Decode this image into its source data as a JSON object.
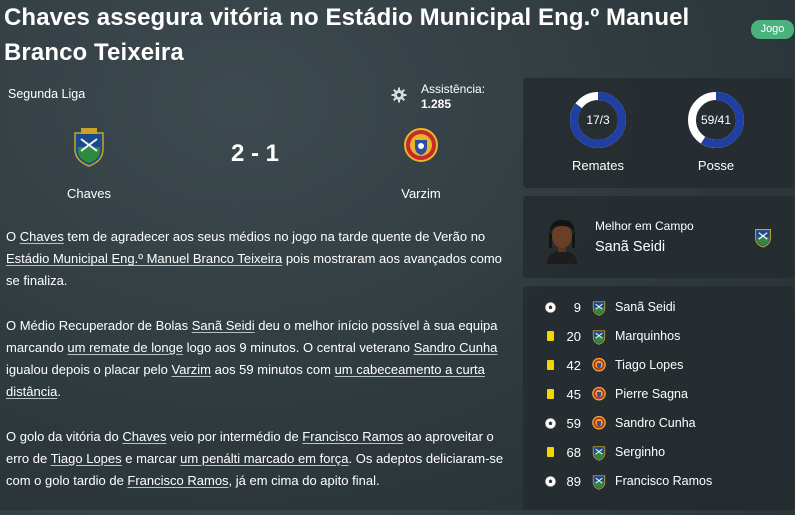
{
  "headline": "Chaves assegura vitória no Estádio Municipal Eng.º Manuel Branco Teixeira",
  "badge": "Jogo",
  "match": {
    "league": "Segunda Liga",
    "attendance_label": "Assistência:",
    "attendance_value": "1.285",
    "home_team": "Chaves",
    "away_team": "Varzim",
    "score": "2 - 1"
  },
  "stats": {
    "shots": {
      "label": "Remates",
      "text": "17/3",
      "home": 17,
      "away": 3
    },
    "possession": {
      "label": "Posse",
      "text": "59/41",
      "home": 59,
      "away": 41
    }
  },
  "motm": {
    "label": "Melhor em Campo",
    "name": "Sanã Seidi"
  },
  "events": [
    {
      "type": "goal",
      "minute": "9",
      "team": "chaves",
      "player": "Sanã Seidi"
    },
    {
      "type": "yellow",
      "minute": "20",
      "team": "chaves",
      "player": "Marquinhos"
    },
    {
      "type": "yellow",
      "minute": "42",
      "team": "varzim",
      "player": "Tiago Lopes"
    },
    {
      "type": "yellow",
      "minute": "45",
      "team": "varzim",
      "player": "Pierre Sagna"
    },
    {
      "type": "goal",
      "minute": "59",
      "team": "varzim",
      "player": "Sandro Cunha"
    },
    {
      "type": "yellow",
      "minute": "68",
      "team": "chaves",
      "player": "Serginho"
    },
    {
      "type": "goal",
      "minute": "89",
      "team": "chaves",
      "player": "Francisco Ramos"
    }
  ],
  "story": {
    "p1": {
      "a": "O ",
      "b": "Chaves",
      "c": " tem de agradecer aos seus médios no jogo na tarde quente de Verão no ",
      "d": "Estádio Municipal Eng.º Manuel Branco Teixeira",
      "e": " pois mostraram aos avançados como se finaliza."
    },
    "p2": {
      "a": "O Médio Recuperador de Bolas ",
      "b": "Sanã Seidi",
      "c": " deu o melhor início possível à sua equipa marcando ",
      "d": "um remate de longe",
      "e": " logo aos 9 minutos. O central veterano ",
      "f": "Sandro Cunha",
      "g": " igualou depois o placar pelo ",
      "h": "Varzim",
      "i": " aos 59 minutos com ",
      "j": "um cabeceamento a curta distância",
      "k": "."
    },
    "p3": {
      "a": "O golo da vitória do ",
      "b": "Chaves",
      "c": " veio por intermédio de ",
      "d": "Francisco Ramos",
      "e": " ao aproveitar o erro de ",
      "f": "Tiago Lopes",
      "g": " e marcar ",
      "h": "um penálti marcado em força",
      "i": ". Os adeptos deliciaram-se com o golo tardio de ",
      "j": "Francisco Ramos",
      "k": ", já em cima do apito final."
    }
  },
  "colors": {
    "accent_ring": "#1f3fa3",
    "ring_rest": "#ffffff",
    "badge": "#4ab37d",
    "yellow_card": "#f2d600"
  }
}
